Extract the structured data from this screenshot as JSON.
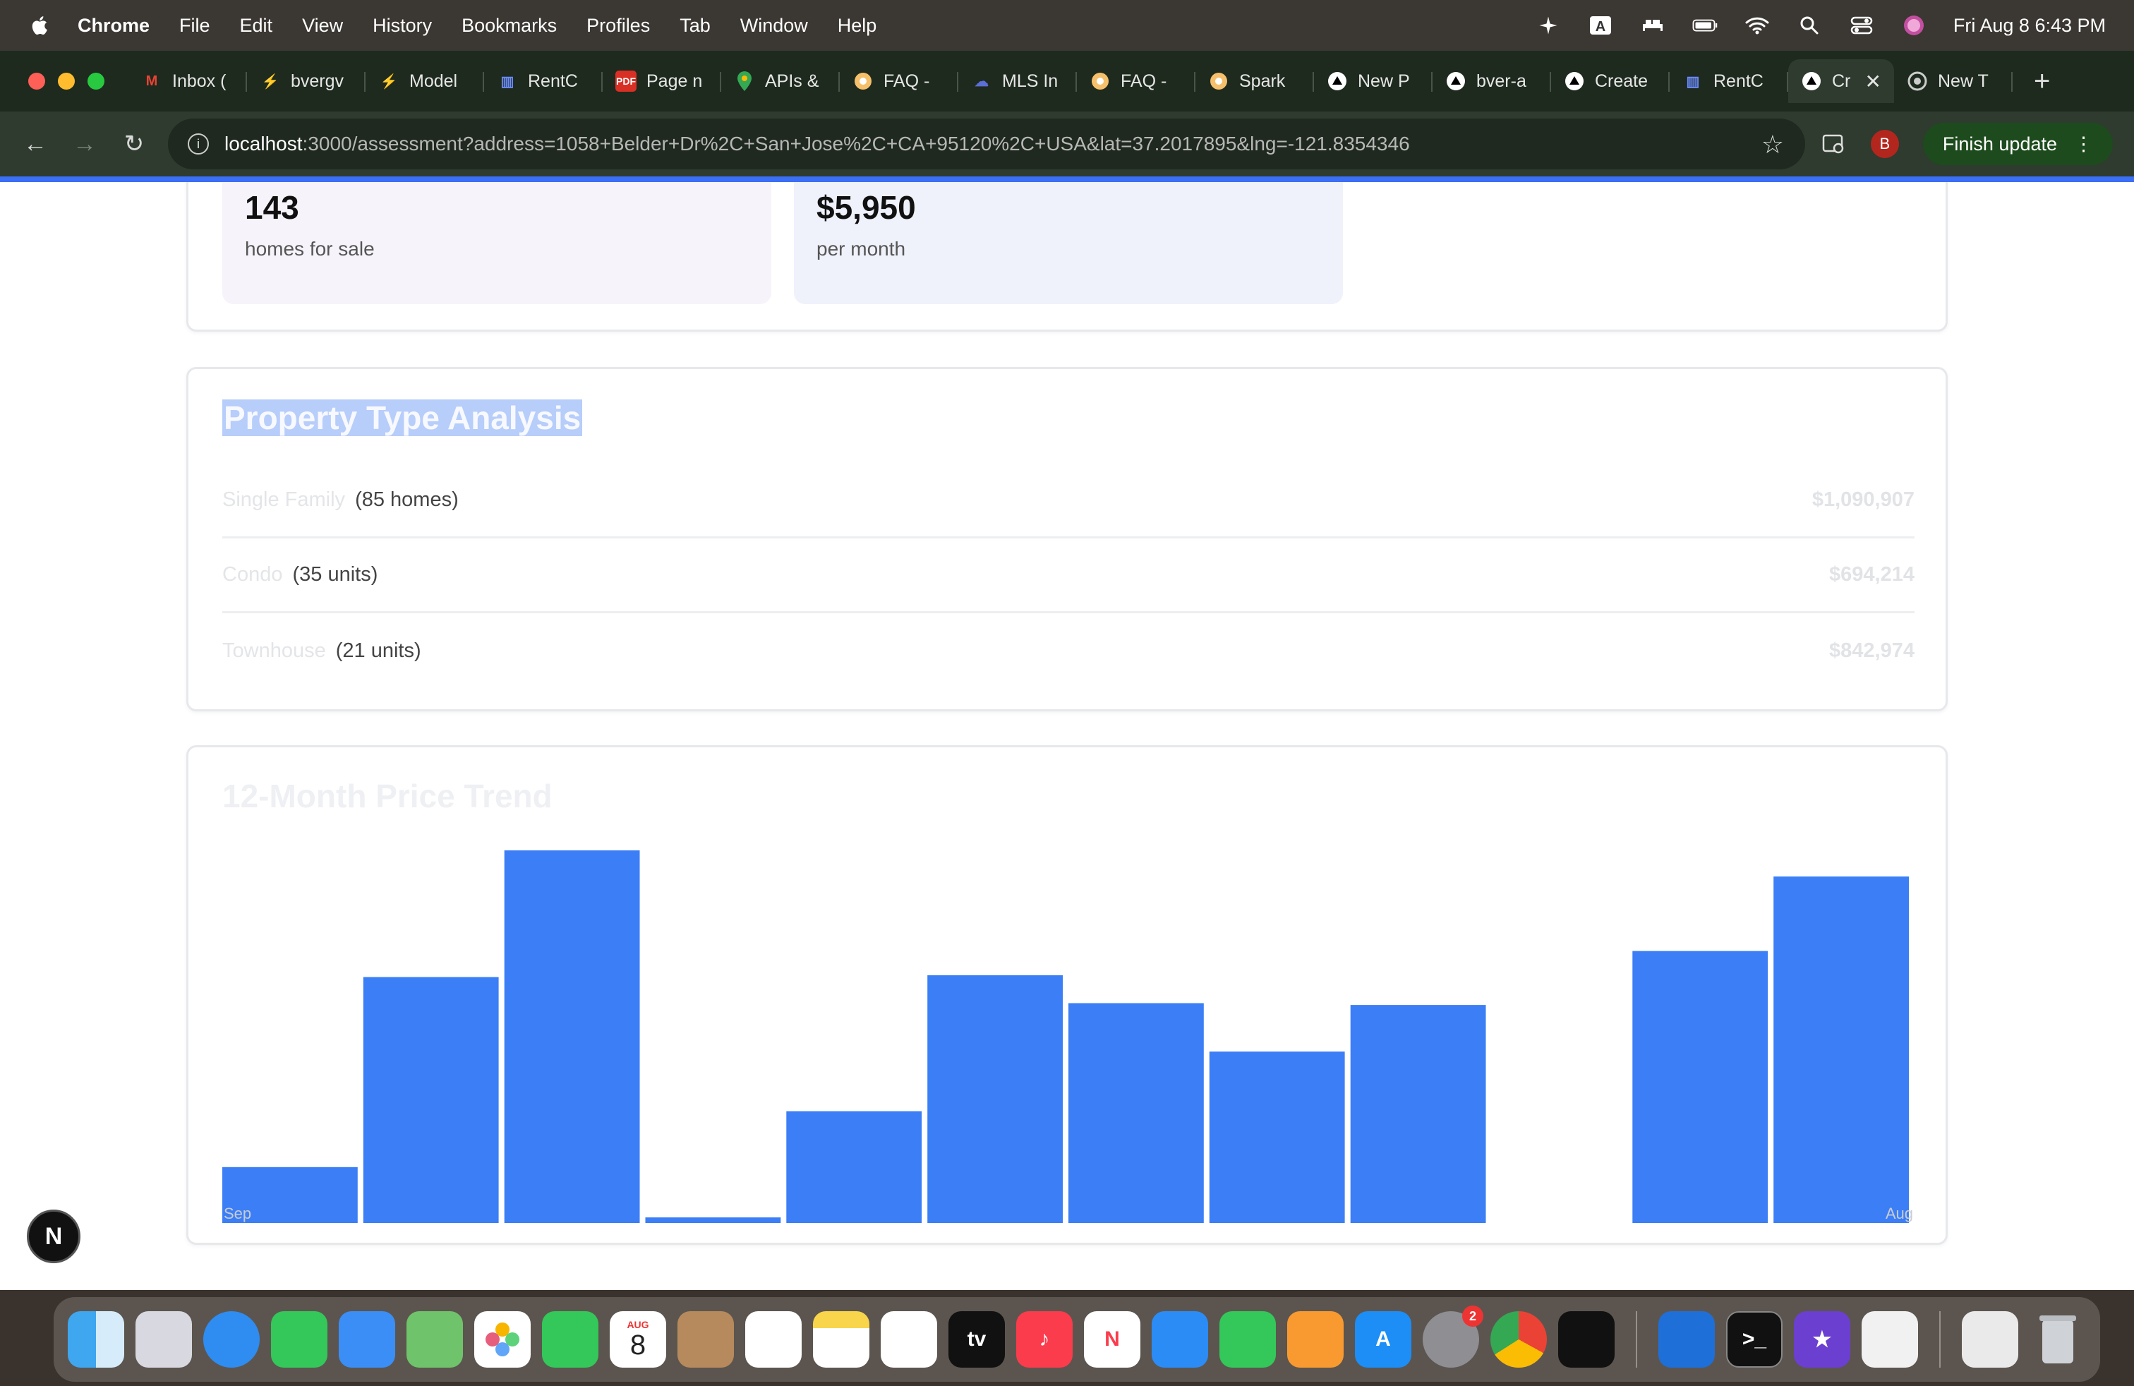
{
  "menubar": {
    "app": "Chrome",
    "items": [
      "File",
      "Edit",
      "View",
      "History",
      "Bookmarks",
      "Profiles",
      "Tab",
      "Window",
      "Help"
    ],
    "clock": "Fri Aug 8  6:43 PM"
  },
  "tabs": [
    {
      "label": "Inbox (",
      "icon": "gmail-icon"
    },
    {
      "label": "bvergv",
      "icon": "bolt-icon"
    },
    {
      "label": "Model",
      "icon": "bolt-icon"
    },
    {
      "label": "RentC",
      "icon": "rentcast-icon"
    },
    {
      "label": "Page n",
      "icon": "pdf-icon"
    },
    {
      "label": "APIs &",
      "icon": "maps-pin-icon"
    },
    {
      "label": "FAQ -",
      "icon": "spark-icon"
    },
    {
      "label": "MLS In",
      "icon": "cloud-icon"
    },
    {
      "label": "FAQ -",
      "icon": "spark-icon"
    },
    {
      "label": "Spark",
      "icon": "spark-icon"
    },
    {
      "label": "New P",
      "icon": "vercel-icon"
    },
    {
      "label": "bver-a",
      "icon": "vercel-icon"
    },
    {
      "label": "Create",
      "icon": "vercel-icon"
    },
    {
      "label": "RentC",
      "icon": "rentcast-icon"
    },
    {
      "label": "Cr",
      "icon": "vercel-icon",
      "active": true
    },
    {
      "label": "New T",
      "icon": "chrome-icon"
    }
  ],
  "toolbar": {
    "url_host": "localhost",
    "url_rest": ":3000/assessment?address=1058+Belder+Dr%2C+San+Jose%2C+CA+95120%2C+USA&lat=37.2017895&lng=-121.8354346",
    "profile_initial": "B",
    "finish_update": "Finish update"
  },
  "stats": [
    {
      "value": "143",
      "label": "homes for sale"
    },
    {
      "value": "$5,950",
      "label": "per month"
    }
  ],
  "property_types": {
    "title": "Property Type Analysis",
    "rows": [
      {
        "name": "Single Family",
        "count": "(85 homes)",
        "price": "$1,090,907"
      },
      {
        "name": "Condo",
        "count": "(35 units)",
        "price": "$694,214"
      },
      {
        "name": "Townhouse",
        "count": "(21 units)",
        "price": "$842,974"
      }
    ]
  },
  "chart_data": {
    "type": "bar",
    "title": "12-Month Price Trend",
    "xlabel": "",
    "ylabel": "",
    "categories": [
      "Sep",
      "",
      "",
      "",
      "",
      "",
      "",
      "",
      "",
      "",
      "",
      "Aug"
    ],
    "values": [
      15,
      66,
      100,
      1.5,
      30,
      66.5,
      59,
      46,
      58.5,
      0,
      73,
      93
    ],
    "ylim": [
      0,
      100
    ],
    "color": "#3b7ef6",
    "grid": false
  },
  "fab_label": "N",
  "dock": {
    "calendar_month": "AUG",
    "calendar_day": "8",
    "settings_badge": "2"
  }
}
